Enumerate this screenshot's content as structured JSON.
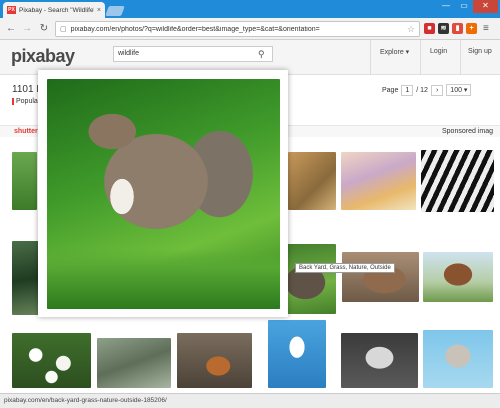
{
  "browser": {
    "tab_title": "Pixabay - Search \"Wildlife\"",
    "favicon_text": "PX",
    "url": "pixabay.com/en/photos/?q=wildlife&order=best&image_type=&cat=&orientation=",
    "window_controls": {
      "minimize": "—",
      "maximize": "▭",
      "close": "✕"
    }
  },
  "site": {
    "logo": "pixabay",
    "search_value": "wildlife",
    "nav": {
      "explore": "Explore ▾",
      "login": "Login",
      "signup": "Sign up"
    }
  },
  "results": {
    "count": "1101 I",
    "filter_tab": "Popular",
    "pager": {
      "label": "Page",
      "current": "1",
      "total": "/ 12",
      "per_page": "100 ▾"
    },
    "shutterstock_label": "shutter",
    "sponsored_label": "Sponsored imag"
  },
  "hover": {
    "tooltip": "Back Yard, Grass, Nature, Outside"
  },
  "status": {
    "text": "pixabay.com/en/back-yard-grass-nature-outside-185206/"
  },
  "colors": {
    "titlebar": "#1f8bd9",
    "accent_red": "#e53935",
    "logo_green": "#7cb342"
  },
  "icons": {
    "back": "←",
    "forward": "→",
    "reload": "↻",
    "star": "☆",
    "menu": "≡",
    "search": "⚲",
    "lock": "🗋"
  }
}
